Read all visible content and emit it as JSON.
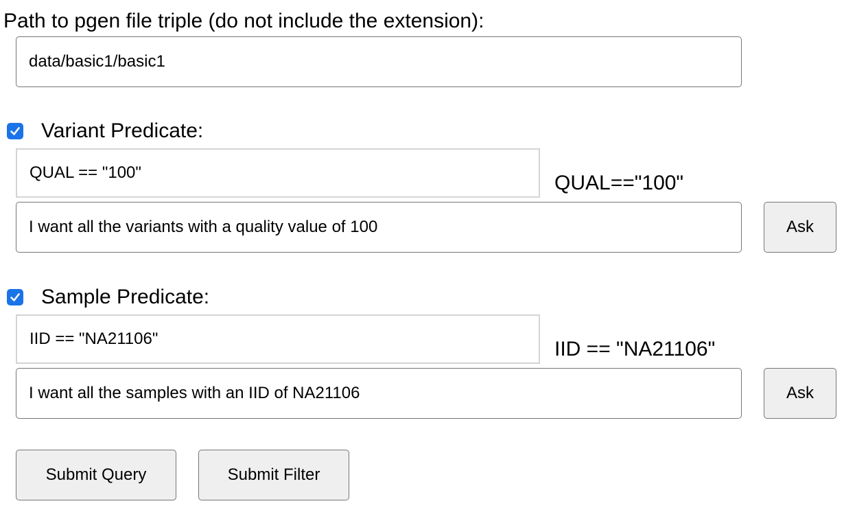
{
  "path": {
    "label": "Path to pgen file triple (do not include the extension):",
    "value": "data/basic1/basic1"
  },
  "variant": {
    "checkbox_checked": true,
    "label": "Variant Predicate:",
    "predicate_value": "QUAL == \"100\"",
    "result": "QUAL==\"100\"",
    "question_value": "I want all the variants with a quality value of 100",
    "ask_label": "Ask"
  },
  "sample": {
    "checkbox_checked": true,
    "label": "Sample Predicate:",
    "predicate_value": "IID == \"NA21106\"",
    "result": "IID == \"NA21106\"",
    "question_value": "I want all the samples with an IID of NA21106",
    "ask_label": "Ask"
  },
  "actions": {
    "submit_query_label": "Submit Query",
    "submit_filter_label": "Submit Filter"
  },
  "colors": {
    "checkbox_accent": "#1a73e8",
    "button_bg": "#efefef",
    "input_border": "#767676"
  }
}
